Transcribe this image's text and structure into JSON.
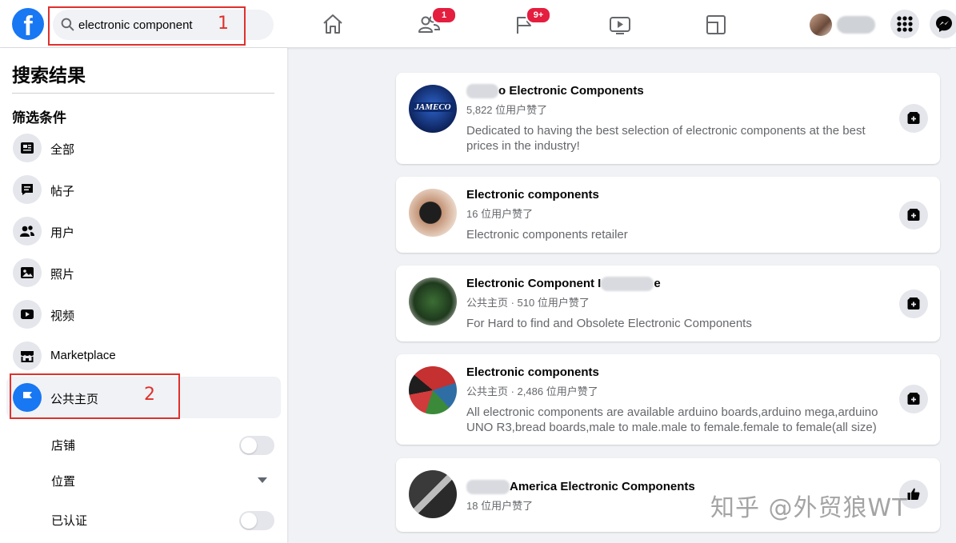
{
  "search": {
    "value": "electronic component"
  },
  "annotations": [
    "1",
    "2"
  ],
  "nav": {
    "friends_badge": "1",
    "pages_badge": "9+"
  },
  "sidebar": {
    "title": "搜索结果",
    "filters_heading": "筛选条件",
    "items": [
      {
        "label": "全部",
        "icon": "news-feed-icon"
      },
      {
        "label": "帖子",
        "icon": "post-icon"
      },
      {
        "label": "用户",
        "icon": "people-icon"
      },
      {
        "label": "照片",
        "icon": "photo-icon"
      },
      {
        "label": "视频",
        "icon": "video-icon"
      },
      {
        "label": "Marketplace",
        "icon": "marketplace-icon"
      },
      {
        "label": "公共主页",
        "icon": "flag-icon",
        "active": true
      }
    ],
    "sub_filters": [
      {
        "label": "店铺",
        "control": "toggle",
        "on": false
      },
      {
        "label": "位置",
        "control": "dropdown"
      },
      {
        "label": "已认证",
        "control": "toggle",
        "on": false
      }
    ]
  },
  "results": [
    {
      "title_suffix": "o Electronic Components",
      "meta": "5,822 位用户赞了",
      "desc": "Dedicated to having the best selection of electronic components at the best prices in the industry!",
      "logo_text": "JAMECO",
      "action": "like-page-icon"
    },
    {
      "title": "Electronic components",
      "meta": "16 位用户赞了",
      "desc": "Electronic components retailer",
      "action": "like-page-icon"
    },
    {
      "title_prefix": "Electronic Component I",
      "title_suffix": "e",
      "meta": "公共主页 · 510 位用户赞了",
      "desc": "For Hard to find and Obsolete Electronic Components",
      "action": "like-page-icon"
    },
    {
      "title": "Electronic components",
      "meta": "公共主页 · 2,486 位用户赞了",
      "desc": "All electronic components are available arduino boards,arduino mega,arduino UNO R3,bread boards,male to male.male to female.female to female(all size)",
      "action": "like-page-icon"
    },
    {
      "title_suffix": "America Electronic Components",
      "meta": "18 位用户赞了",
      "action": "thumbs-up-icon"
    }
  ],
  "watermark": "知乎 @外贸狼WT",
  "colors": {
    "brand": "#1877f2",
    "annotation": "#e0302c",
    "badge": "#e41e3f"
  }
}
